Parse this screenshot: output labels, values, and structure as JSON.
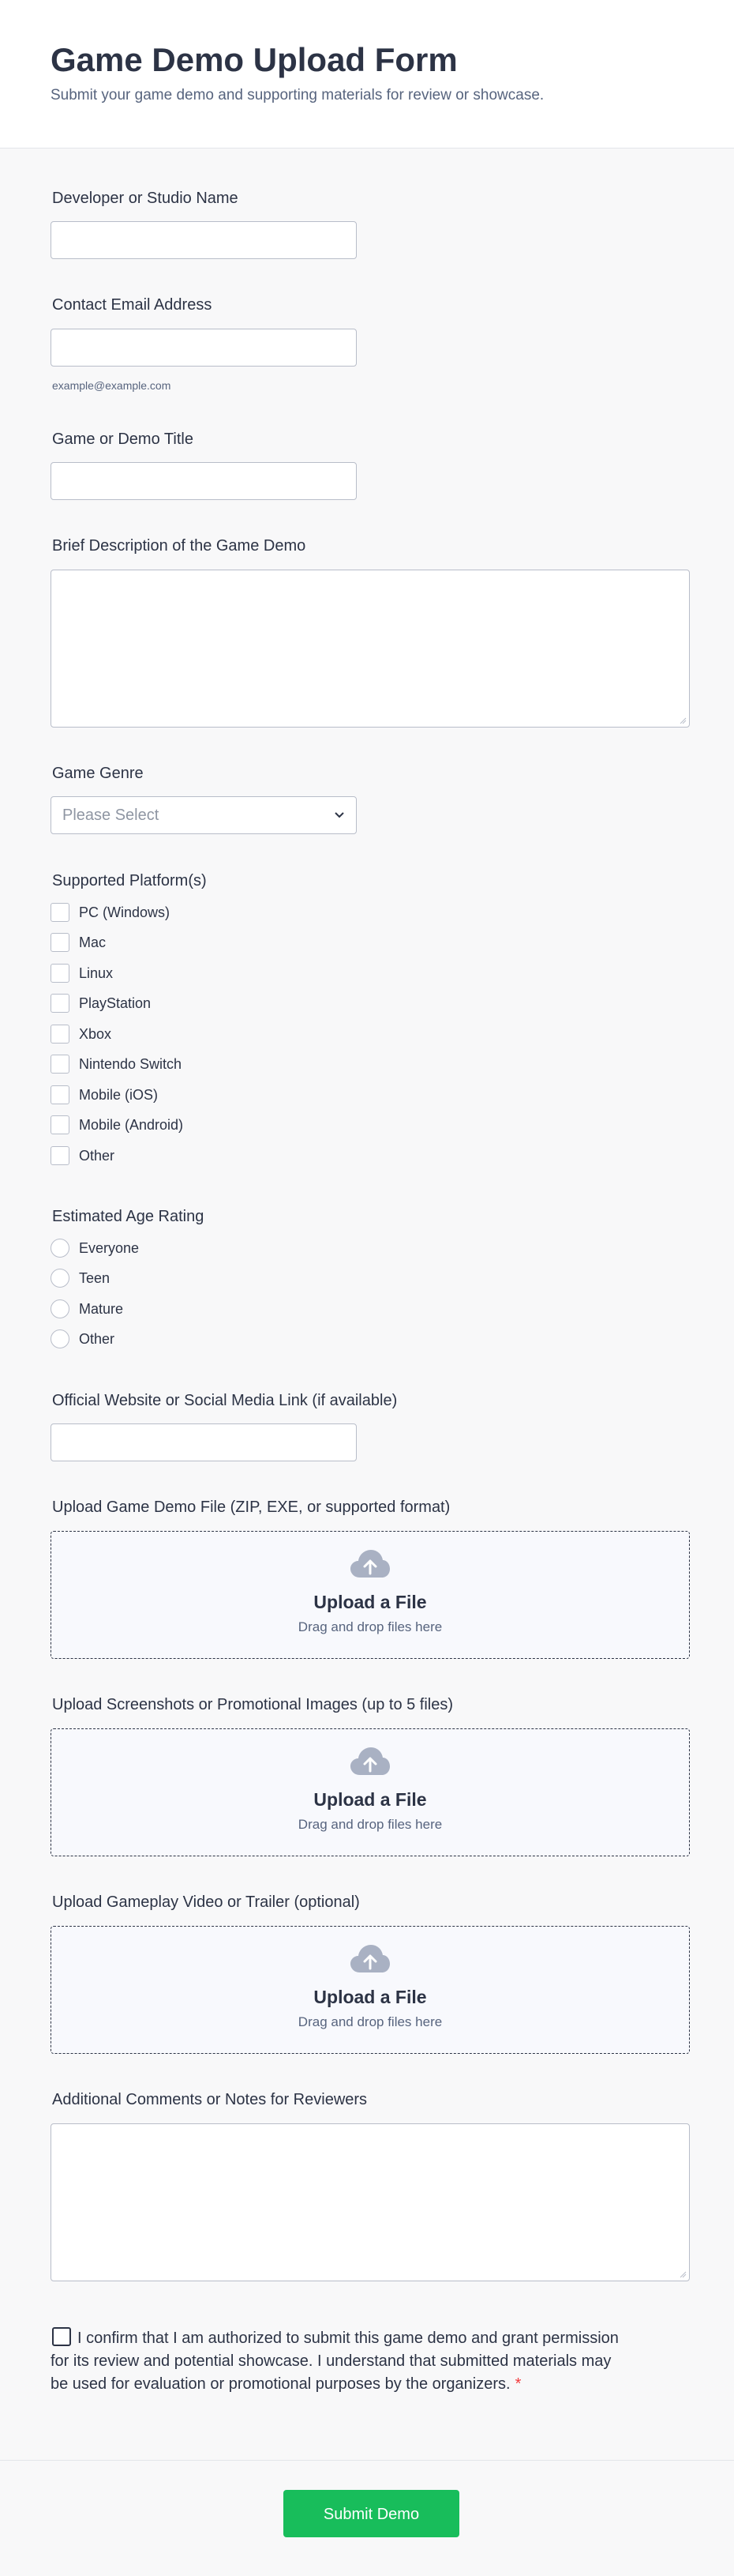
{
  "header": {
    "title": "Game Demo Upload Form",
    "subtitle": "Submit your game demo and supporting materials for review or showcase."
  },
  "fields": {
    "developer": {
      "label": "Developer or Studio Name"
    },
    "email": {
      "label": "Contact Email Address",
      "sublabel": "example@example.com"
    },
    "game_title": {
      "label": "Game or Demo Title"
    },
    "description": {
      "label": "Brief Description of the Game Demo"
    },
    "genre": {
      "label": "Game Genre",
      "placeholder": "Please Select"
    },
    "platforms": {
      "label": "Supported Platform(s)",
      "options": [
        "PC (Windows)",
        "Mac",
        "Linux",
        "PlayStation",
        "Xbox",
        "Nintendo Switch",
        "Mobile (iOS)",
        "Mobile (Android)",
        "Other"
      ]
    },
    "age_rating": {
      "label": "Estimated Age Rating",
      "options": [
        "Everyone",
        "Teen",
        "Mature",
        "Other"
      ]
    },
    "website": {
      "label": "Official Website or Social Media Link (if available)"
    },
    "demo_file": {
      "label": "Upload Game Demo File (ZIP, EXE, or supported format)",
      "title": "Upload a File",
      "sub": "Drag and drop files here"
    },
    "screenshots": {
      "label": "Upload Screenshots or Promotional Images (up to 5 files)",
      "title": "Upload a File",
      "sub": "Drag and drop files here"
    },
    "video": {
      "label": "Upload Gameplay Video or Trailer (optional)",
      "title": "Upload a File",
      "sub": "Drag and drop files here"
    },
    "comments": {
      "label": "Additional Comments or Notes for Reviewers"
    },
    "consent": {
      "text": "I confirm that I am authorized to submit this game demo and grant permission for its review and potential showcase. I understand that submitted materials may be used for evaluation or promotional purposes by the organizers.",
      "required_mark": "*"
    }
  },
  "submit": {
    "label": "Submit Demo"
  },
  "colors": {
    "accent": "#18bd5b",
    "required": "#f23a3c",
    "upload_icon": "#a9b1c3"
  }
}
